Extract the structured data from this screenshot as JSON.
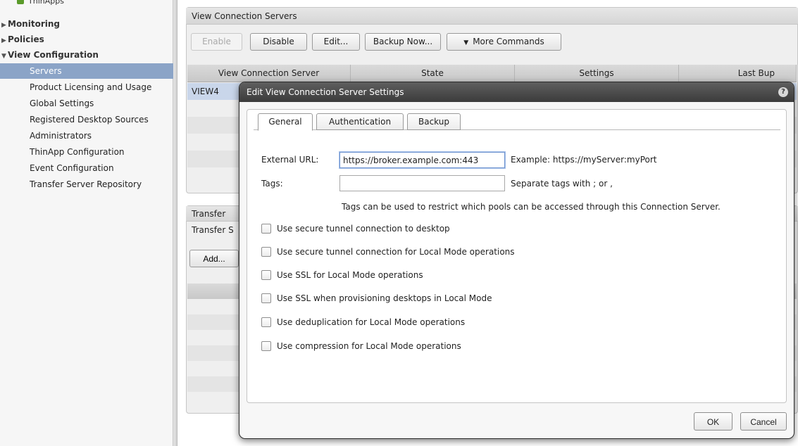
{
  "sidebar": {
    "top_item": "ThinApps",
    "sections": [
      {
        "label": "Monitoring",
        "expanded": false
      },
      {
        "label": "Policies",
        "expanded": false
      },
      {
        "label": "View Configuration",
        "expanded": true
      }
    ],
    "items": [
      {
        "label": "Servers",
        "selected": true
      },
      {
        "label": "Product Licensing and Usage"
      },
      {
        "label": "Global Settings"
      },
      {
        "label": "Registered Desktop Sources"
      },
      {
        "label": "Administrators"
      },
      {
        "label": "ThinApp Configuration"
      },
      {
        "label": "Event Configuration"
      },
      {
        "label": "Transfer Server Repository"
      }
    ]
  },
  "main": {
    "panel_title": "View Connection Servers",
    "toolbar": {
      "enable": "Enable",
      "disable": "Disable",
      "edit": "Edit...",
      "backup_now": "Backup Now...",
      "more_commands": "More Commands"
    },
    "columns": [
      "View Connection Server",
      "State",
      "Settings",
      "Last Bup"
    ],
    "rows": [
      {
        "server": "VIEW4"
      }
    ],
    "transfer_panel": {
      "title": "Transfer",
      "subtitle": "Transfer S",
      "add_button": "Add..."
    }
  },
  "dialog": {
    "title": "Edit View Connection Server Settings",
    "tabs": [
      "General",
      "Authentication",
      "Backup"
    ],
    "active_tab": "General",
    "fields": {
      "external_url_label": "External URL:",
      "external_url_value": "https://broker.example.com:443",
      "external_url_hint": "Example: https://myServer:myPort",
      "tags_label": "Tags:",
      "tags_value": "",
      "tags_hint": "Separate tags with ; or ,",
      "tags_note": "Tags can be used to restrict which pools can be accessed through this Connection Server."
    },
    "checkboxes": [
      {
        "label": "Use secure tunnel connection to desktop",
        "checked": false
      },
      {
        "label": "Use secure tunnel connection for Local Mode operations",
        "checked": false
      },
      {
        "label": "Use SSL for Local Mode operations",
        "checked": false
      },
      {
        "label": "Use SSL when provisioning desktops in Local Mode",
        "checked": false
      },
      {
        "label": "Use deduplication for Local Mode operations",
        "checked": false
      },
      {
        "label": "Use compression for Local Mode operations",
        "checked": false
      }
    ],
    "ok": "OK",
    "cancel": "Cancel"
  },
  "colors": {
    "selection": "#8ba4c7",
    "dialog_titlebar": "#3b3b3b",
    "focus_border": "#6d93cf"
  }
}
